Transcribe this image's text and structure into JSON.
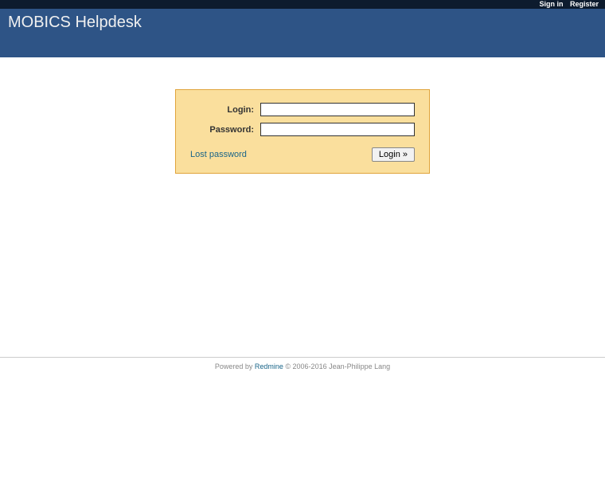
{
  "top_menu": {
    "sign_in": "Sign in",
    "register": "Register"
  },
  "header": {
    "title": "MOBICS Helpdesk"
  },
  "login": {
    "login_label": "Login:",
    "password_label": "Password:",
    "lost_password": "Lost password",
    "submit_label": "Login »"
  },
  "footer": {
    "powered_by": "Powered by ",
    "redmine_link": "Redmine",
    "copyright": " © 2006-2016 Jean-Philippe Lang"
  }
}
